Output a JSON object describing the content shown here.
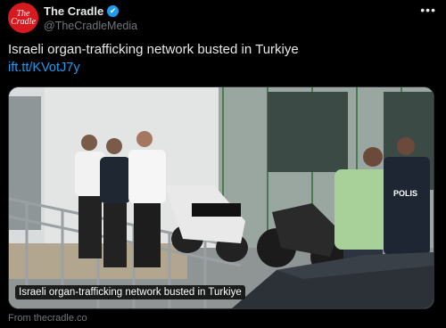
{
  "tweet": {
    "avatar_text_1": "The",
    "avatar_text_2": "Cradle",
    "display_name": "The Cradle",
    "verified_glyph": "✔",
    "handle": "@TheCradleMedia",
    "more_glyph": "•••",
    "text": "Israeli organ-trafficking network busted in Turkiye",
    "link": "ift.tt/KVotJ7y"
  },
  "media": {
    "caption": "Israeli organ-trafficking network busted in Turkiye",
    "police_vest_label": "POLIS"
  },
  "card": {
    "source": "From thecradle.co"
  },
  "colors": {
    "accent": "#1d9bf0",
    "brand_red": "#d71920",
    "background": "#000000",
    "muted": "#71767b"
  },
  "icons": {
    "verified": "verified-badge-icon",
    "more": "more-options-icon"
  }
}
